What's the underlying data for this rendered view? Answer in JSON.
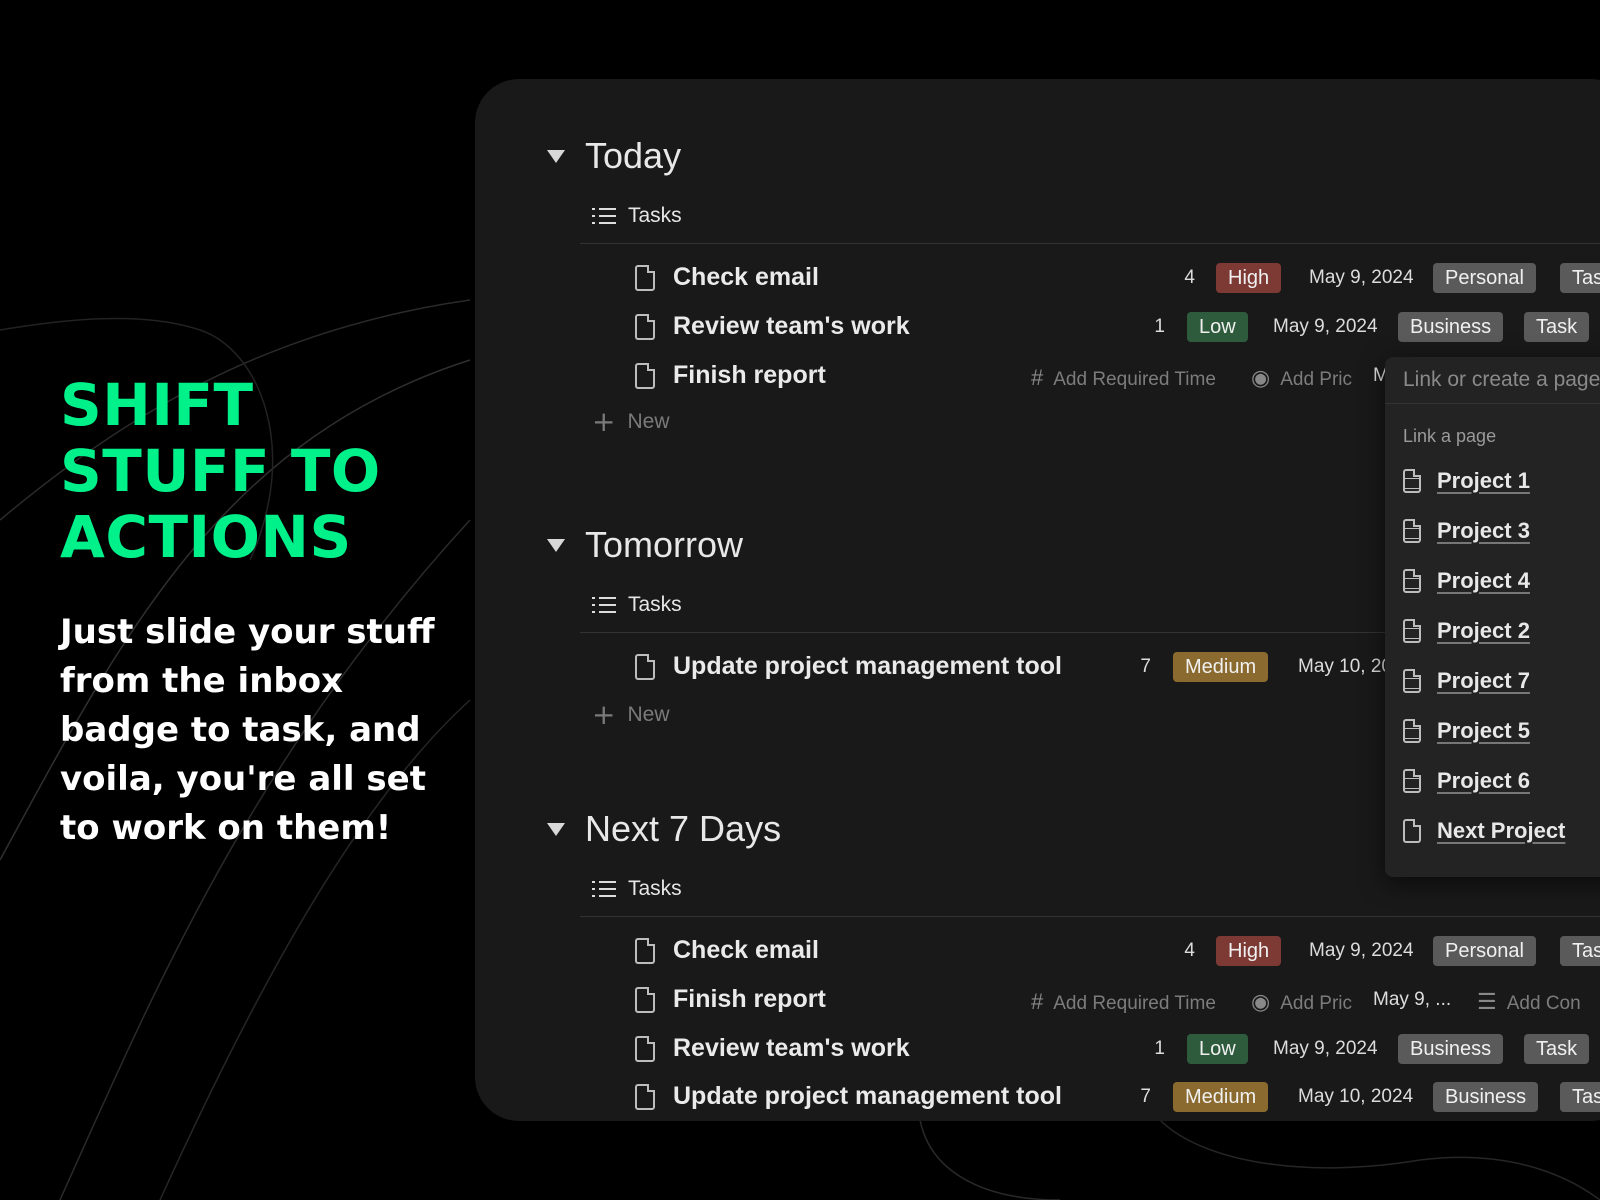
{
  "hero": {
    "title_lines": [
      "SHIFT",
      "STUFF TO",
      "ACTIONS"
    ],
    "body": "Just slide your stuff from the inbox badge to task, and voila, you're all set to work on them!",
    "accent_color": "#00f08a"
  },
  "sections": {
    "today": {
      "title": "Today",
      "view_label": "Tasks",
      "new_label": "New",
      "rows": [
        {
          "name": "Check email",
          "time": "4",
          "priority": "High",
          "date": "May 9, 2024",
          "area": "Personal",
          "type": "Tas"
        },
        {
          "name": "Review team's work",
          "time": "1",
          "priority": "Low",
          "date": "May 9, 2024",
          "area": "Business",
          "type": "Task"
        },
        {
          "name": "Finish report",
          "add_time": "Add Required Time",
          "add_priority": "Add Pric",
          "date_partial": "M"
        }
      ]
    },
    "tomorrow": {
      "title": "Tomorrow",
      "view_label": "Tasks",
      "new_label": "New",
      "rows": [
        {
          "name": "Update project management tool",
          "time": "7",
          "priority": "Medium",
          "date": "May 10, 20"
        }
      ]
    },
    "next7": {
      "title": "Next 7 Days",
      "view_label": "Tasks",
      "rows": [
        {
          "name": "Check email",
          "time": "4",
          "priority": "High",
          "date": "May 9, 2024",
          "area": "Personal",
          "type": "Tas"
        },
        {
          "name": "Finish report",
          "add_time": "Add Required Time",
          "add_priority": "Add Pric",
          "date": "May 9, ...",
          "add_context": "Add Con"
        },
        {
          "name": "Review team's work",
          "time": "1",
          "priority": "Low",
          "date": "May 9, 2024",
          "area": "Business",
          "type": "Task"
        },
        {
          "name": "Update project management tool",
          "time": "7",
          "priority": "Medium",
          "date": "May 10, 2024",
          "area": "Business",
          "type": "Tas"
        }
      ]
    }
  },
  "popup": {
    "search_placeholder": "Link or create a page",
    "section_label": "Link a page",
    "items": [
      "Project 1",
      "Project 3",
      "Project 4",
      "Project 2",
      "Project 7",
      "Project 5",
      "Project 6",
      "Next Project"
    ]
  },
  "colors": {
    "high": "#7d3a35",
    "low": "#2e5b3b",
    "medium": "#8a6a2e",
    "tag": "#5a5a5a",
    "panel": "#191919"
  }
}
